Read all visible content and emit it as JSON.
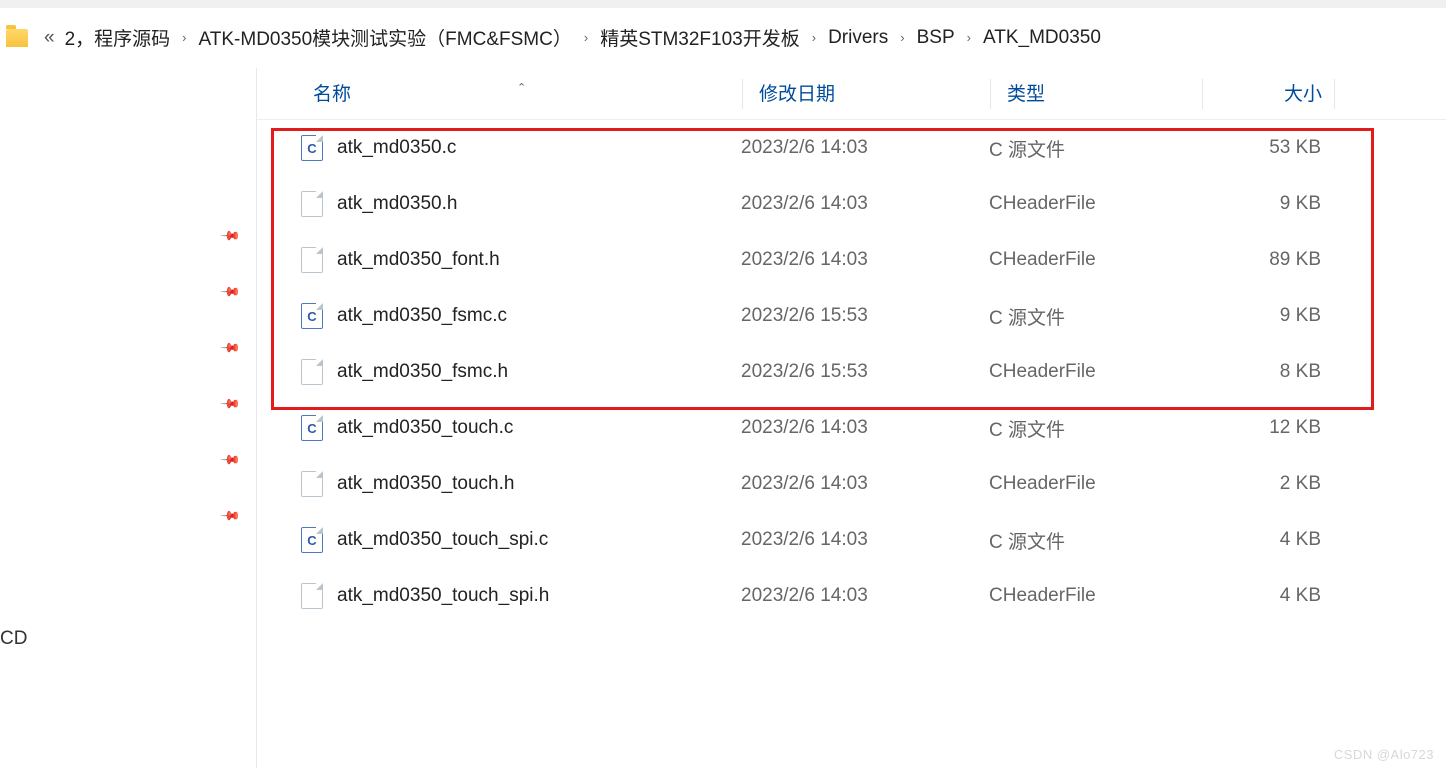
{
  "breadcrumb": {
    "items": [
      "2，程序源码",
      "ATK-MD0350模块测试实验（FMC&FSMC）",
      "精英STM32F103开发板",
      "Drivers",
      "BSP",
      "ATK_MD0350"
    ]
  },
  "nav": {
    "cd_label": "CD"
  },
  "columns": {
    "name": "名称",
    "date": "修改日期",
    "type": "类型",
    "size": "大小"
  },
  "files": [
    {
      "name": "atk_md0350.c",
      "date": "2023/2/6 14:03",
      "type": "C 源文件",
      "size": "53 KB",
      "icon": "c",
      "pinned": false
    },
    {
      "name": "atk_md0350.h",
      "date": "2023/2/6 14:03",
      "type": "CHeaderFile",
      "size": "9 KB",
      "icon": "h",
      "pinned": true
    },
    {
      "name": "atk_md0350_font.h",
      "date": "2023/2/6 14:03",
      "type": "CHeaderFile",
      "size": "89 KB",
      "icon": "h",
      "pinned": true
    },
    {
      "name": "atk_md0350_fsmc.c",
      "date": "2023/2/6 15:53",
      "type": "C 源文件",
      "size": "9 KB",
      "icon": "c",
      "pinned": true
    },
    {
      "name": "atk_md0350_fsmc.h",
      "date": "2023/2/6 15:53",
      "type": "CHeaderFile",
      "size": "8 KB",
      "icon": "h",
      "pinned": true
    },
    {
      "name": "atk_md0350_touch.c",
      "date": "2023/2/6 14:03",
      "type": "C 源文件",
      "size": "12 KB",
      "icon": "c",
      "pinned": true
    },
    {
      "name": "atk_md0350_touch.h",
      "date": "2023/2/6 14:03",
      "type": "CHeaderFile",
      "size": "2 KB",
      "icon": "h",
      "pinned": true
    },
    {
      "name": "atk_md0350_touch_spi.c",
      "date": "2023/2/6 14:03",
      "type": "C 源文件",
      "size": "4 KB",
      "icon": "c",
      "pinned": false
    },
    {
      "name": "atk_md0350_touch_spi.h",
      "date": "2023/2/6 14:03",
      "type": "CHeaderFile",
      "size": "4 KB",
      "icon": "h",
      "pinned": false
    }
  ],
  "watermark": "CSDN @Alo723"
}
